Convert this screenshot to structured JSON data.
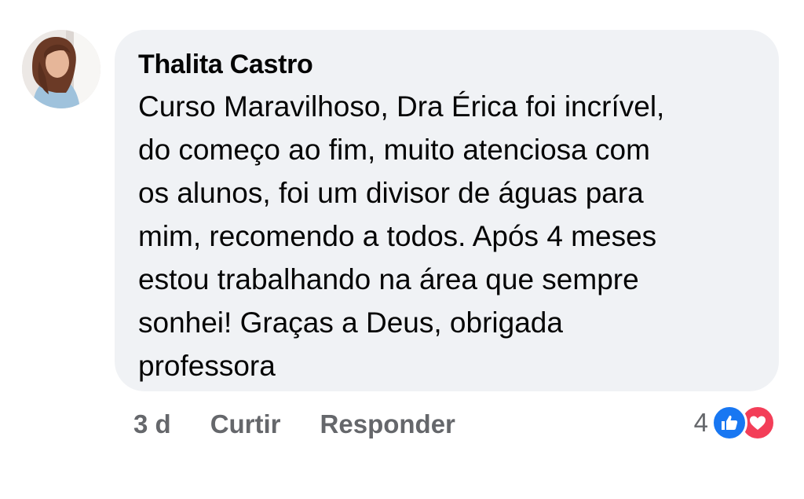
{
  "comment": {
    "author": "Thalita Castro",
    "lines": [
      "Curso Maravilhoso, Dra Érica foi incrível,",
      "do começo ao fim, muito atenciosa com",
      "os alunos, foi um divisor de águas para",
      "mim, recomendo a todos. Após 4 meses",
      "estou trabalhando na área que sempre",
      "sonhei! Graças a Deus, obrigada",
      "professora"
    ],
    "time": "3 d",
    "like_label": "Curtir",
    "reply_label": "Responder",
    "reaction_count": "4",
    "reaction_icons": [
      "thumbs-up-icon",
      "heart-icon"
    ]
  },
  "colors": {
    "bubble_bg": "#f0f2f5",
    "text": "#050505",
    "secondary": "#65676b",
    "like_blue": "#1877f2",
    "love_red": "#f33e58"
  }
}
